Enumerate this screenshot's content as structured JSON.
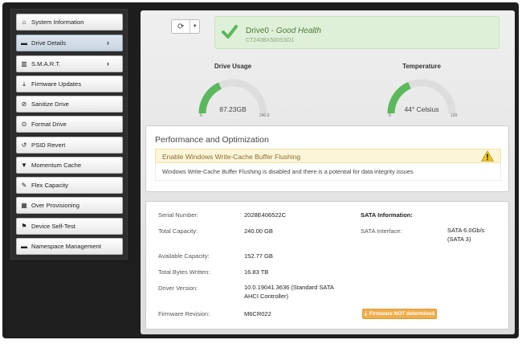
{
  "sidebar": {
    "items": [
      {
        "label": "System Information",
        "icon": "home-icon",
        "active": false,
        "chevron": false
      },
      {
        "label": "Drive Details",
        "icon": "drive-icon",
        "active": true,
        "chevron": true
      },
      {
        "label": "S.M.A.R.T.",
        "icon": "chart-icon",
        "active": false,
        "chevron": true
      },
      {
        "label": "Firmware Updates",
        "icon": "download-icon",
        "active": false,
        "chevron": false
      },
      {
        "label": "Sanitize Drive",
        "icon": "ban-icon",
        "active": false,
        "chevron": false
      },
      {
        "label": "Format Drive",
        "icon": "format-icon",
        "active": false,
        "chevron": false
      },
      {
        "label": "PSID Revert",
        "icon": "undo-icon",
        "active": false,
        "chevron": false
      },
      {
        "label": "Momentum Cache",
        "icon": "filter-icon",
        "active": false,
        "chevron": false
      },
      {
        "label": "Flex Capacity",
        "icon": "edit-icon",
        "active": false,
        "chevron": false
      },
      {
        "label": "Over Provisioning",
        "icon": "grid-icon",
        "active": false,
        "chevron": false
      },
      {
        "label": "Device Self-Test",
        "icon": "flag-icon",
        "active": false,
        "chevron": false
      },
      {
        "label": "Namespace Management",
        "icon": "drive-icon",
        "active": false,
        "chevron": false
      }
    ]
  },
  "health": {
    "drive": "Drive0",
    "separator": " - ",
    "status": "Good Health",
    "model": "CT240BX500SSD1",
    "color": "#5cb85c"
  },
  "gauges": {
    "usage": {
      "label": "Drive Usage",
      "value_text": "87.23GB",
      "min": "0",
      "max": "240.0",
      "fraction": 0.36
    },
    "temperature": {
      "label": "Temperature",
      "value_text": "44° Celsius",
      "min": "0",
      "max": "120",
      "fraction": 0.37
    }
  },
  "performance": {
    "title": "Performance and Optimization",
    "warning_title": "Enable Windows Write-Cache Buffer Flushing",
    "warning_body": "Windows Write-Cache Buffer Flushing is disabled and there is a potential for data integrity issues."
  },
  "info": {
    "serial_label": "Serial Number:",
    "serial": "2028E406522C",
    "sata_info_label": "SATA Information:",
    "capacity_label": "Total Capacity:",
    "capacity": "240.00 GB",
    "sata_interface_label": "SATA Interface:",
    "sata_interface_1": "SATA 6.0Gb/s",
    "sata_interface_2": "(SATA 3)",
    "available_label": "Available Capacity:",
    "available": "152.77 GB",
    "written_label": "Total Bytes Written:",
    "written": "16.83 TB",
    "driver_label": "Driver Version:",
    "driver_1": "10.0.19041.3636 (Standard SATA",
    "driver_2": "AHCI Controller)",
    "firmware_label": "Firmware Revision:",
    "firmware": "M6CR022",
    "firmware_badge": "Firmware NOT determined"
  },
  "colors": {
    "accent_green": "#5cb85c",
    "warning": "#f0ad4e",
    "gauge_track": "#dddddd"
  }
}
